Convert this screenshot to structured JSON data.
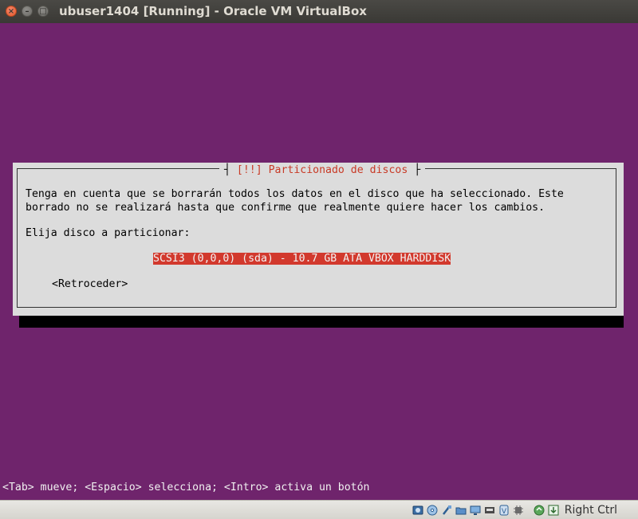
{
  "window": {
    "title": "ubuser1404 [Running] - Oracle VM VirtualBox",
    "close_glyph": "×",
    "min_glyph": "–",
    "max_glyph": "□"
  },
  "dialog": {
    "title": "[!!] Particionado de discos",
    "message_line1": "Tenga en cuenta que se borrarán todos los datos en el disco que ha seleccionado. Este",
    "message_line2": "borrado no se realizará hasta que confirme que realmente quiere hacer los cambios.",
    "prompt": "Elija disco a particionar:",
    "disk_option": "SCSI3 (0,0,0) (sda) - 10.7 GB ATA VBOX HARDDISK",
    "back_button": "<Retroceder>"
  },
  "help_line": "<Tab> mueve; <Espacio> selecciona; <Intro> activa un botón",
  "statusbar": {
    "host_key": "Right Ctrl",
    "icons": [
      "hard-disk-icon",
      "optical-drive-icon",
      "usb-icon",
      "shared-folders-icon",
      "display-icon",
      "network-icon",
      "recording-icon",
      "mouse-integration-icon",
      "keyboard-capture-icon"
    ]
  },
  "colors": {
    "screen_background": "#6f246c",
    "dialog_background": "#dcdcdc",
    "dialog_title": "#c83a26",
    "selection": "#d2392d"
  }
}
